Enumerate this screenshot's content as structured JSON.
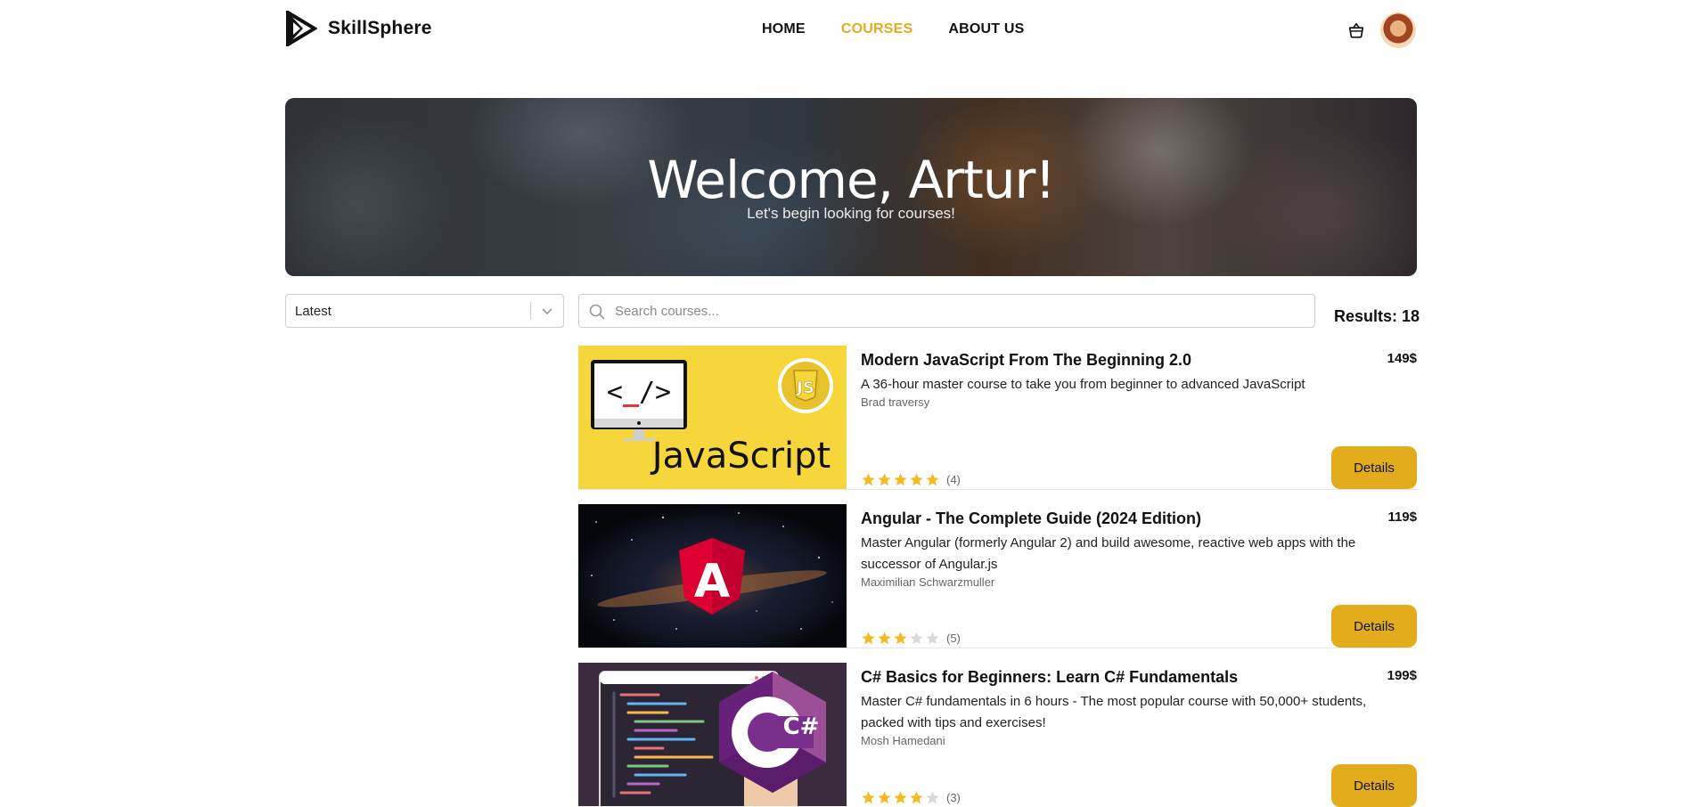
{
  "brand": {
    "name": "SkillSphere"
  },
  "nav": {
    "items": [
      {
        "label": "HOME",
        "active": false
      },
      {
        "label": "COURSES",
        "active": true
      },
      {
        "label": "ABOUT US",
        "active": false
      }
    ]
  },
  "header_icons": {
    "cart": "shopping-basket-icon",
    "avatar": "user-avatar"
  },
  "hero": {
    "title": "Welcome, Artur!",
    "subtitle": "Let's begin looking for courses!"
  },
  "controls": {
    "sort_value": "Latest",
    "search_placeholder": "Search courses...",
    "search_value": "",
    "results_label": "Results: 18"
  },
  "courses": [
    {
      "title": "Modern JavaScript From The Beginning 2.0",
      "price": "149$",
      "description": "A 36-hour master course to take you from beginner to advanced JavaScript",
      "author": "Brad traversy",
      "rating": 5,
      "rating_count": "(4)",
      "button_label": "Details",
      "thumb_text": "JavaScript",
      "thumb_code": "<_/>",
      "thumb_badge": "JS"
    },
    {
      "title": "Angular - The Complete Guide (2024 Edition)",
      "price": "119$",
      "description": "Master Angular (formerly Angular 2) and build awesome, reactive web apps with the successor of Angular.js",
      "author": "Maximilian Schwarzmuller",
      "rating": 3,
      "rating_count": "(5)",
      "button_label": "Details",
      "thumb_badge": "A"
    },
    {
      "title": "C# Basics for Beginners: Learn C# Fundamentals",
      "price": "199$",
      "description": "Master C# fundamentals in 6 hours - The most popular course with 50,000+ students, packed with tips and exercises!",
      "author": "Mosh Hamedani",
      "rating": 4,
      "rating_count": "(3)",
      "button_label": "Details",
      "thumb_badge": "C#"
    }
  ],
  "colors": {
    "accent": "#e2ac1d",
    "star_filled": "#f5b921",
    "star_empty": "#d9d9d9"
  }
}
